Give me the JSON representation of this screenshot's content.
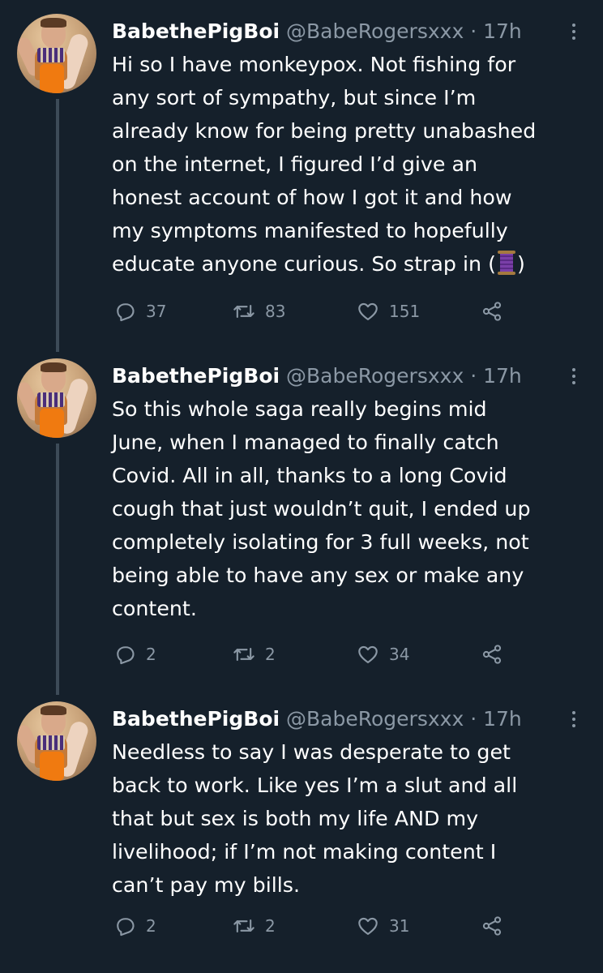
{
  "tweets": [
    {
      "display_name": "BabethePigBoi",
      "handle": "@BabeRogersxxx",
      "separator": "·",
      "time": "17h",
      "text": "Hi so I have monkeypox. Not fishing for\nany sort of sympathy, but since I’m\nalready know for being pretty unabashed\non the internet, I figured I’d give an\nhonest account of how I got it and how\nmy symptoms manifested to hopefully\neducate anyone curious. So strap in (",
      "text_end": ")",
      "emoji": "spool-of-thread-emoji",
      "replies": "37",
      "retweets": "83",
      "likes": "151"
    },
    {
      "display_name": "BabethePigBoi",
      "handle": "@BabeRogersxxx",
      "separator": "·",
      "time": "17h",
      "text": "So this whole saga really begins mid\nJune, when I managed to finally catch\nCovid. All in all, thanks to a long Covid\ncough that just wouldn’t quit, I ended up\ncompletely isolating for 3 full weeks, not\nbeing able to have any sex or make any\ncontent.",
      "replies": "2",
      "retweets": "2",
      "likes": "34"
    },
    {
      "display_name": "BabethePigBoi",
      "handle": "@BabeRogersxxx",
      "separator": "·",
      "time": "17h",
      "text": "Needless to say I was desperate to get\nback to work. Like yes I’m a slut and all\nthat but sex is both my life AND my\nlivelihood; if I’m not making content I\ncan’t pay my bills.",
      "replies": "2",
      "retweets": "2",
      "likes": "31"
    }
  ],
  "colors": {
    "background": "#15202b",
    "text_primary": "#ffffff",
    "text_secondary": "#8b98a5",
    "thread_line": "#3d4b58"
  },
  "icons": {
    "reply": "reply-icon",
    "retweet": "retweet-icon",
    "like": "heart-icon",
    "share": "share-icon",
    "more": "more-options-icon"
  }
}
